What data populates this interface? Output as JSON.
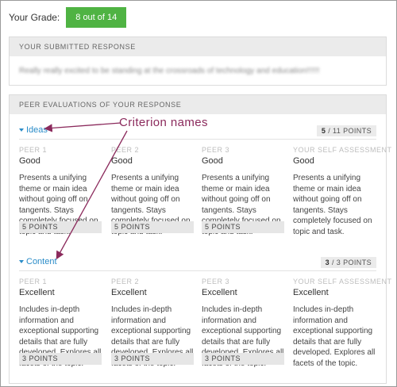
{
  "grade": {
    "label": "Your Grade:",
    "value": "8 out of 14"
  },
  "submitted": {
    "heading": "YOUR SUBMITTED RESPONSE",
    "text": "Really really excited to be standing at the crossroads of technology and education!!!!!!"
  },
  "peer_evaluations": {
    "heading": "PEER EVALUATIONS OF YOUR RESPONSE",
    "criteria": [
      {
        "name": "Ideas",
        "earned": "5",
        "possible": "/ 11",
        "points_word": "POINTS",
        "assessments": [
          {
            "who": "PEER 1",
            "rating": "Good",
            "description": "Presents a unifying theme or main idea without going off on tangents. Stays completely focused on topic and task.",
            "points": "5 POINTS"
          },
          {
            "who": "PEER 2",
            "rating": "Good",
            "description": "Presents a unifying theme or main idea without going off on tangents. Stays completely focused on topic and task.",
            "points": "5 POINTS"
          },
          {
            "who": "PEER 3",
            "rating": "Good",
            "description": "Presents a unifying theme or main idea without going off on tangents. Stays completely focused on topic and task.",
            "points": "5 POINTS"
          },
          {
            "who": "YOUR SELF ASSESSMENT",
            "rating": "Good",
            "description": "Presents a unifying theme or main idea without going off on tangents. Stays completely focused on topic and task.",
            "points": ""
          }
        ]
      },
      {
        "name": "Content",
        "earned": "3",
        "possible": "/ 3",
        "points_word": "POINTS",
        "assessments": [
          {
            "who": "PEER 1",
            "rating": "Excellent",
            "description": "Includes in-depth information and exceptional supporting details that are fully developed. Explores all facets of the topic.",
            "points": "3 POINTS"
          },
          {
            "who": "PEER 2",
            "rating": "Excellent",
            "description": "Includes in-depth information and exceptional supporting details that are fully developed. Explores all facets of the topic.",
            "points": "3 POINTS"
          },
          {
            "who": "PEER 3",
            "rating": "Excellent",
            "description": "Includes in-depth information and exceptional supporting details that are fully developed. Explores all facets of the topic.",
            "points": "3 POINTS"
          },
          {
            "who": "YOUR SELF ASSESSMENT",
            "rating": "Excellent",
            "description": "Includes in-depth information and exceptional supporting details that are fully developed. Explores all facets of the topic.",
            "points": ""
          }
        ]
      }
    ]
  },
  "annotation": {
    "text": "Criterion  names",
    "color": "#8b2a5c"
  },
  "colors": {
    "grade_badge": "#4fb343",
    "criterion_link": "#2a8cc8"
  }
}
